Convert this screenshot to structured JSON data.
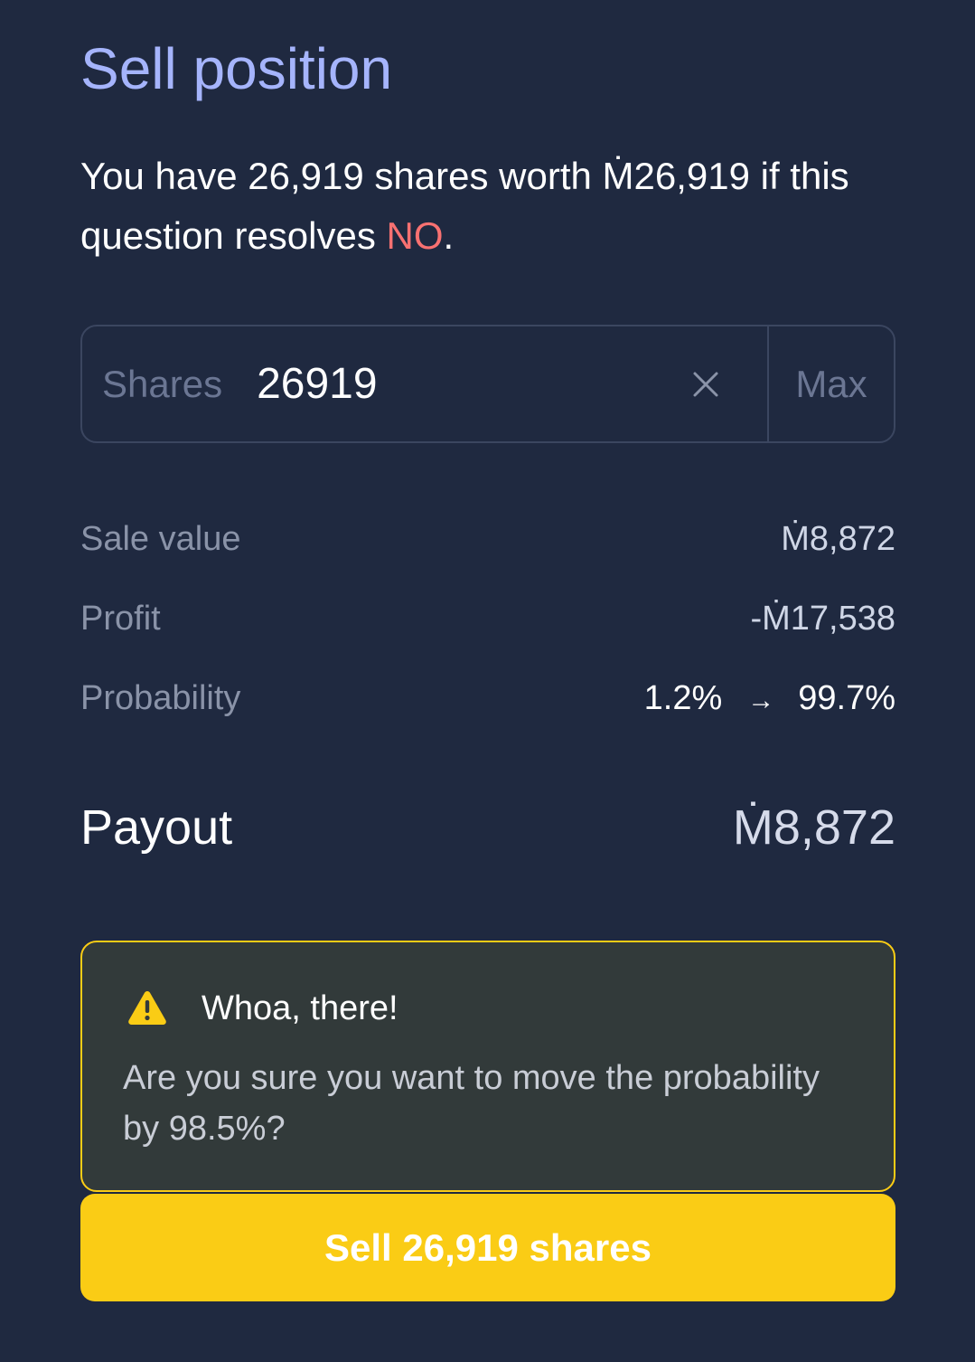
{
  "title": "Sell position",
  "intro": {
    "prefix": "You have 26,919 shares worth Ṁ26,919 if this question resolves ",
    "outcome": "NO",
    "suffix": "."
  },
  "input": {
    "prefix_label": "Shares",
    "value": "26919",
    "max_label": "Max"
  },
  "summary": {
    "sale_value_label": "Sale value",
    "sale_value": "Ṁ8,872",
    "profit_label": "Profit",
    "profit": "-Ṁ17,538",
    "probability_label": "Probability",
    "probability_from": "1.2%",
    "probability_arrow": "→",
    "probability_to": "99.7%"
  },
  "payout": {
    "label": "Payout",
    "value": "Ṁ8,872"
  },
  "warning": {
    "icon": "warning-triangle-icon",
    "title": "Whoa, there!",
    "text": "Are you sure you want to move the probability by 98.5%?"
  },
  "sell_button_label": "Sell 26,919 shares",
  "colors": {
    "background": "#1f2940",
    "title": "#a5b4fc",
    "no_outcome": "#f87171",
    "warning_border": "#facc15",
    "button": "#facc15"
  }
}
